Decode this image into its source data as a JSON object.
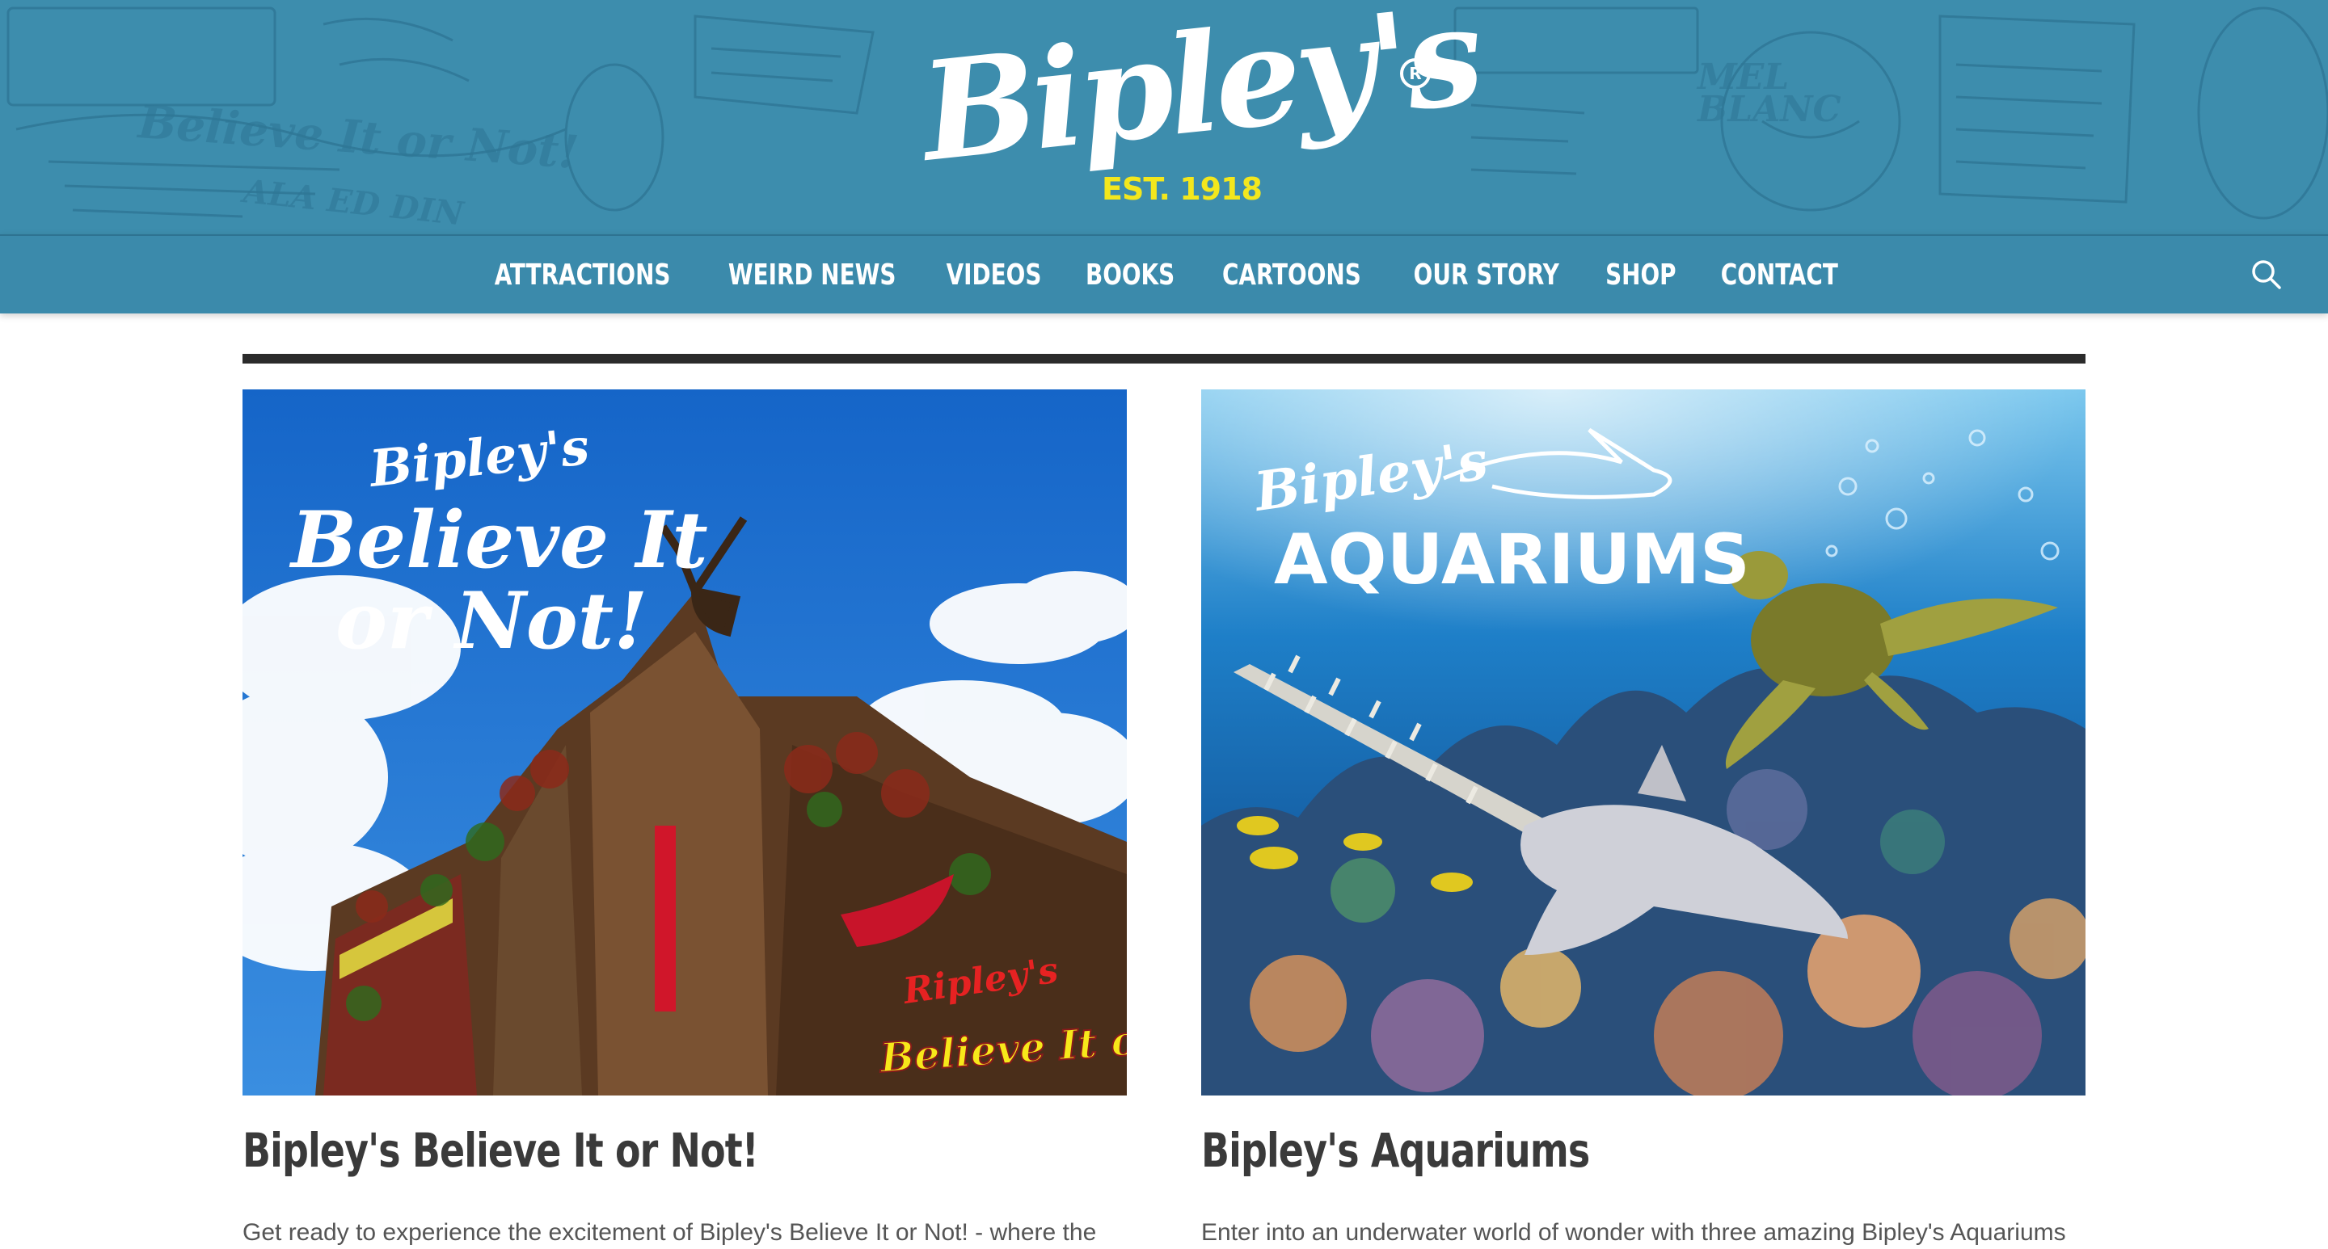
{
  "header": {
    "logo_text": "Bipley's",
    "logo_registered": "R",
    "logo_tagline": "EST. 1918",
    "background_color": "#3d8dad",
    "tagline_color": "#f3e71d"
  },
  "nav": {
    "items": [
      {
        "label": "ATTRACTIONS"
      },
      {
        "label": "WEIRD NEWS"
      },
      {
        "label": "VIDEOS"
      },
      {
        "label": "BOOKS"
      },
      {
        "label": "CARTOONS"
      },
      {
        "label": "OUR STORY"
      },
      {
        "label": "SHOP"
      },
      {
        "label": "CONTACT"
      }
    ],
    "search_icon": "search-icon"
  },
  "cards": [
    {
      "image_brand": "Bipley's",
      "image_line1": "Believe It",
      "image_line2": "or Not!",
      "image_sign_brand": "Ripley's",
      "image_sign_text": "Believe It or Not!",
      "title": "Bipley's Believe It or Not!",
      "description": "Get ready to experience the excitement of Bipley's Believe It or Not! - where the"
    },
    {
      "image_brand": "Bipley's",
      "image_line1": "AQUARIUMS",
      "title": "Bipley's Aquariums",
      "description": "Enter into an underwater world of wonder with three amazing Bipley's Aquariums"
    }
  ]
}
